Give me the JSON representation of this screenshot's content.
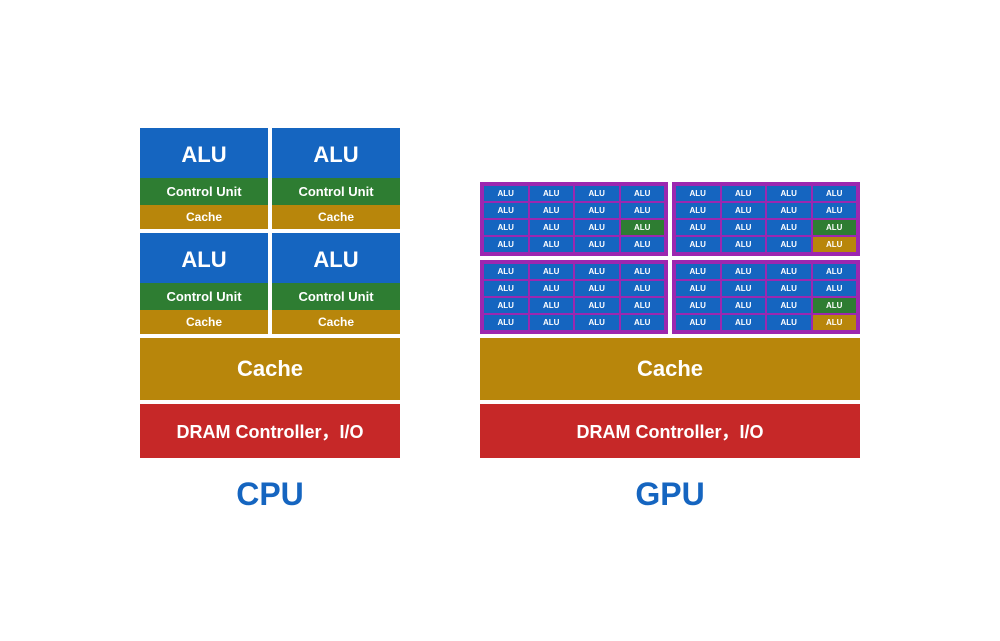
{
  "cpu": {
    "label": "CPU",
    "cores": [
      {
        "alu": "ALU",
        "control": "Control Unit",
        "cache": "Cache"
      },
      {
        "alu": "ALU",
        "control": "Control Unit",
        "cache": "Cache"
      },
      {
        "alu": "ALU",
        "control": "Control Unit",
        "cache": "Cache"
      },
      {
        "alu": "ALU",
        "control": "Control Unit",
        "cache": "Cache"
      }
    ],
    "shared_cache": "Cache",
    "dram": "DRAM Controller，I/O"
  },
  "gpu": {
    "label": "GPU",
    "alu_label": "ALU",
    "shared_cache": "Cache",
    "dram": "DRAM Controller，I/O",
    "clusters": 4,
    "rows_per_cluster": 4,
    "alus_per_row": 4
  }
}
